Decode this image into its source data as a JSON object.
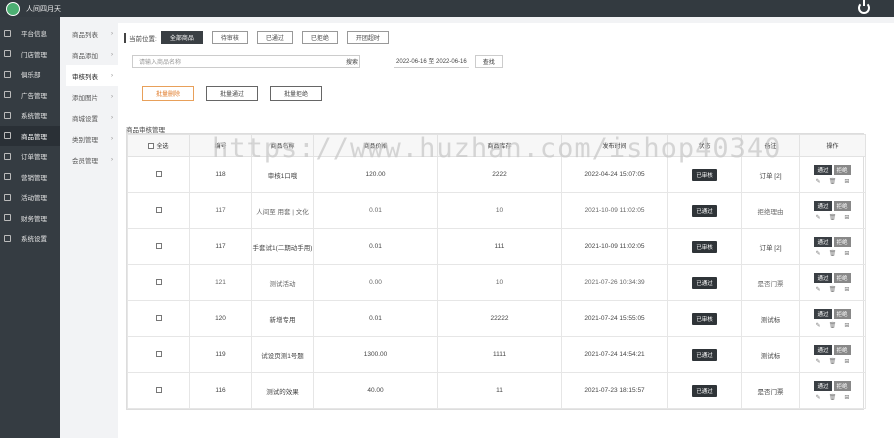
{
  "header": {
    "title": "人间四月天"
  },
  "sidebar": {
    "items": [
      {
        "label": "平台信息",
        "icon": "monitor-icon"
      },
      {
        "label": "门店管理",
        "icon": "store-icon"
      },
      {
        "label": "俱乐部",
        "icon": "club-icon"
      },
      {
        "label": "广告管理",
        "icon": "ad-icon"
      },
      {
        "label": "系统管理",
        "icon": "settings-icon"
      },
      {
        "label": "商品管理",
        "icon": "goods-icon",
        "active": true
      },
      {
        "label": "订单管理",
        "icon": "order-icon"
      },
      {
        "label": "营销管理",
        "icon": "marketing-icon"
      },
      {
        "label": "活动管理",
        "icon": "activity-icon"
      },
      {
        "label": "财务管理",
        "icon": "finance-icon"
      },
      {
        "label": "系统设置",
        "icon": "gear-icon"
      }
    ]
  },
  "subnav": {
    "items": [
      {
        "label": "商品列表"
      },
      {
        "label": "商品添加"
      },
      {
        "label": "审核列表",
        "active": true
      },
      {
        "label": "添加图片"
      },
      {
        "label": "商城设置"
      },
      {
        "label": "类别管理"
      },
      {
        "label": "会员管理"
      }
    ]
  },
  "filters": {
    "crumb": "当前位置:",
    "tabs": [
      "全部商品",
      "待审核",
      "已通过",
      "已拒绝",
      "开团超时"
    ],
    "search_placeholder": "请输入商品名称",
    "search_button": "搜索",
    "date_range": "2022-06-16 至 2022-06-16",
    "query_button": "查找"
  },
  "bulk": {
    "buttons": [
      "批量删除",
      "批量通过",
      "批量拒绝"
    ]
  },
  "table": {
    "title": "商品审核管理",
    "headers": [
      "全选",
      "编号",
      "商品名称",
      "商品价格",
      "商品库存",
      "发布时间",
      "状态",
      "备注",
      "操作"
    ],
    "rows": [
      {
        "id": "118",
        "name": "审核1口哦",
        "price": "120.00",
        "stock": "2222",
        "time": "2022-04-24 15:07:05",
        "status": "已审核",
        "note": "订单 [2]",
        "dim": false
      },
      {
        "id": "117",
        "name": "人间至 用套 | 文化",
        "price": "0.01",
        "stock": "10",
        "time": "2021-10-09 11:02:05",
        "status": "已通过",
        "note": "拒绝理由",
        "dim": true
      },
      {
        "id": "117",
        "name": "手套试1(二期动手用)",
        "price": "0.01",
        "stock": "111",
        "time": "2021-10-09 11:02:05",
        "status": "已审核",
        "note": "订单 [2]",
        "dim": false
      },
      {
        "id": "121",
        "name": "测试活动",
        "price": "0.00",
        "stock": "10",
        "time": "2021-07-26 10:34:39",
        "status": "已通过",
        "note": "是否门票",
        "dim": true
      },
      {
        "id": "120",
        "name": "新增专用",
        "price": "0.01",
        "stock": "22222",
        "time": "2021-07-24 15:55:05",
        "status": "已审核",
        "note": "测试标",
        "dim": false
      },
      {
        "id": "119",
        "name": "试设页测1号题",
        "price": "1300.00",
        "stock": "1111",
        "time": "2021-07-24 14:54:21",
        "status": "已通过",
        "note": "测试标",
        "dim": false
      },
      {
        "id": "116",
        "name": "测试的效果",
        "price": "40.00",
        "stock": "11",
        "time": "2021-07-23 18:15:57",
        "status": "已通过",
        "note": "是否门票",
        "dim": false
      }
    ],
    "op_labels": {
      "approve": "通过",
      "reject": "拒绝"
    }
  },
  "watermark": "https://www.huzhan.com/ishop40340"
}
